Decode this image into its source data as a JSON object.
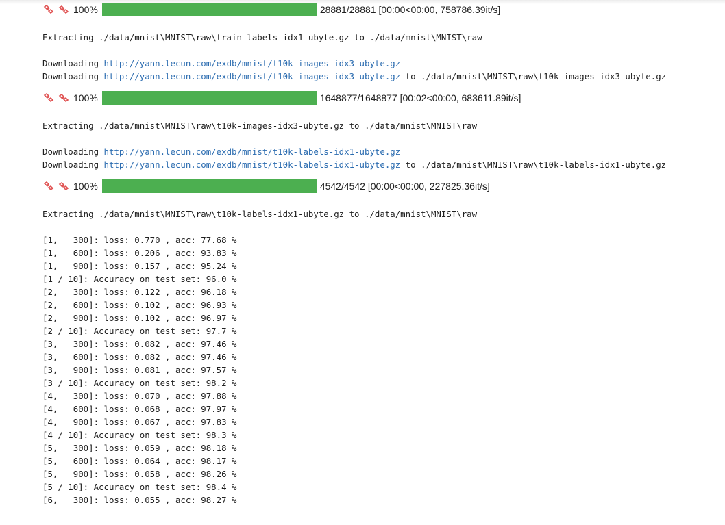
{
  "progress_blocks": [
    {
      "percent_label": "100%",
      "fill": 1.0,
      "stats": "28881/28881 [00:00<00:00, 758786.39it/s]"
    },
    {
      "percent_label": "100%",
      "fill": 1.0,
      "stats": "1648877/1648877 [00:02<00:00, 683611.89it/s]"
    },
    {
      "percent_label": "100%",
      "fill": 1.0,
      "stats": "4542/4542 [00:00<00:00, 227825.36it/s]"
    }
  ],
  "extract_lines": [
    "Extracting ./data/mnist\\MNIST\\raw\\train-labels-idx1-ubyte.gz to ./data/mnist\\MNIST\\raw",
    "Extracting ./data/mnist\\MNIST\\raw\\t10k-images-idx3-ubyte.gz to ./data/mnist\\MNIST\\raw",
    "Extracting ./data/mnist\\MNIST\\raw\\t10k-labels-idx1-ubyte.gz to ./data/mnist\\MNIST\\raw"
  ],
  "download_blocks": [
    {
      "prefix": "Downloading ",
      "url": "http://yann.lecun.com/exdb/mnist/t10k-images-idx3-ubyte.gz",
      "to_text": " to ./data/mnist\\MNIST\\raw\\t10k-images-idx3-ubyte.gz"
    },
    {
      "prefix": "Downloading ",
      "url": "http://yann.lecun.com/exdb/mnist/t10k-labels-idx1-ubyte.gz",
      "to_text": " to ./data/mnist\\MNIST\\raw\\t10k-labels-idx1-ubyte.gz"
    }
  ],
  "training_log": [
    "[1,   300]: loss: 0.770 , acc: 77.68 %",
    "[1,   600]: loss: 0.206 , acc: 93.83 %",
    "[1,   900]: loss: 0.157 , acc: 95.24 %",
    "[1 / 10]: Accuracy on test set: 96.0 %",
    "[2,   300]: loss: 0.122 , acc: 96.18 %",
    "[2,   600]: loss: 0.102 , acc: 96.93 %",
    "[2,   900]: loss: 0.102 , acc: 96.97 %",
    "[2 / 10]: Accuracy on test set: 97.7 %",
    "[3,   300]: loss: 0.082 , acc: 97.46 %",
    "[3,   600]: loss: 0.082 , acc: 97.46 %",
    "[3,   900]: loss: 0.081 , acc: 97.57 %",
    "[3 / 10]: Accuracy on test set: 98.2 %",
    "[4,   300]: loss: 0.070 , acc: 97.88 %",
    "[4,   600]: loss: 0.068 , acc: 97.97 %",
    "[4,   900]: loss: 0.067 , acc: 97.83 %",
    "[4 / 10]: Accuracy on test set: 98.3 %",
    "[5,   300]: loss: 0.059 , acc: 98.18 %",
    "[5,   600]: loss: 0.064 , acc: 98.17 %",
    "[5,   900]: loss: 0.058 , acc: 98.26 %",
    "[5 / 10]: Accuracy on test set: 98.4 %",
    "[6,   300]: loss: 0.055 , acc: 98.27 %"
  ],
  "colors": {
    "bar_fill": "#4caf50",
    "link": "#2b6cb0",
    "icon": "#e05050"
  },
  "icons": [
    "broken-link-icon",
    "broken-link-icon"
  ]
}
